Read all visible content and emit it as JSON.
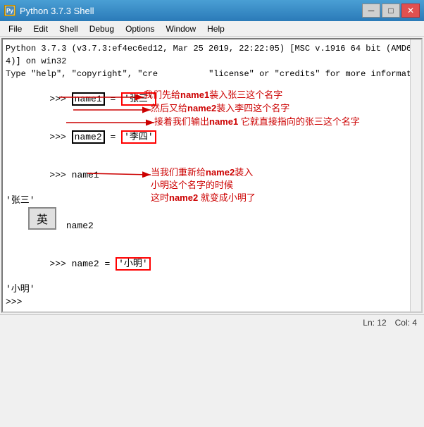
{
  "window": {
    "title": "Python 3.7.3 Shell",
    "icon": "Py"
  },
  "titlebar": {
    "minimize": "─",
    "maximize": "□",
    "close": "✕"
  },
  "menu": {
    "items": [
      "File",
      "Edit",
      "Shell",
      "Debug",
      "Options",
      "Window",
      "Help"
    ]
  },
  "shell": {
    "header_line1": "Python 3.7.3 (v3.7.3:ef4ec6ed12, Mar 25 2019, 22:22:05) [MSC v.1916 64 bit (AMD6",
    "header_line2": "4)] on win32",
    "header_line3": "Type \"help\", \"copyright\", \"cre          \"license\" or \"credits\" for more information.",
    "lines": [
      ">>> name1 = '张三'",
      ">>> name2 = '李四'",
      ">>> name1",
      "'张三'",
      "   name2",
      ">>> name2 = '小明'",
      "'小明'",
      ">>> "
    ]
  },
  "annotations": {
    "ann1": "我们先给name1装入张三这个名字",
    "ann2": "然后又给name2装入李四这个名字",
    "ann3": "接着我们输出name1 它就直接指向的张三这个名字",
    "ann4": "当我们重新给name2装入",
    "ann5": "小明这个名字的时候",
    "ann6": "这时name2 就变成小明了"
  },
  "statusbar": {
    "ln": "Ln: 12",
    "col": "Col: 4"
  },
  "ying": "英"
}
